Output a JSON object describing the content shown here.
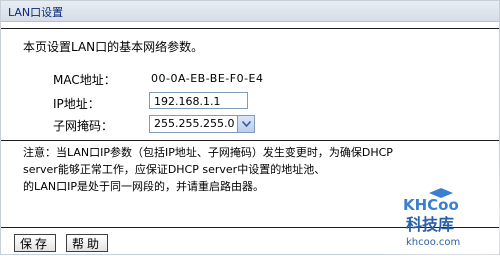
{
  "window": {
    "title": "LAN口设置"
  },
  "intro": "本页设置LAN口的基本网络参数。",
  "fields": {
    "mac": {
      "label": "MAC地址：",
      "value": "00-0A-EB-BE-F0-E4"
    },
    "ip": {
      "label": "IP地址：",
      "value": "192.168.1.1"
    },
    "mask": {
      "label": "子网掩码：",
      "value": "255.255.255.0"
    }
  },
  "note": {
    "line1": "注意：当LAN口IP参数（包括IP地址、子网掩码）发生变更时，为确保DHCP",
    "line2": "server能够正常工作，应保证DHCP server中设置的地址池、",
    "line3": "的LAN口IP是处于同一网段的，并请重启路由器。"
  },
  "buttons": {
    "save": "保存",
    "help": "帮助"
  },
  "watermark": {
    "logo": "KHCoo",
    "name": "科技库",
    "url": "khcoo.com"
  },
  "colors": {
    "titlebar": "#d6dde6",
    "title_text": "#0a2a7a",
    "watermark": "#2b5fa8"
  }
}
